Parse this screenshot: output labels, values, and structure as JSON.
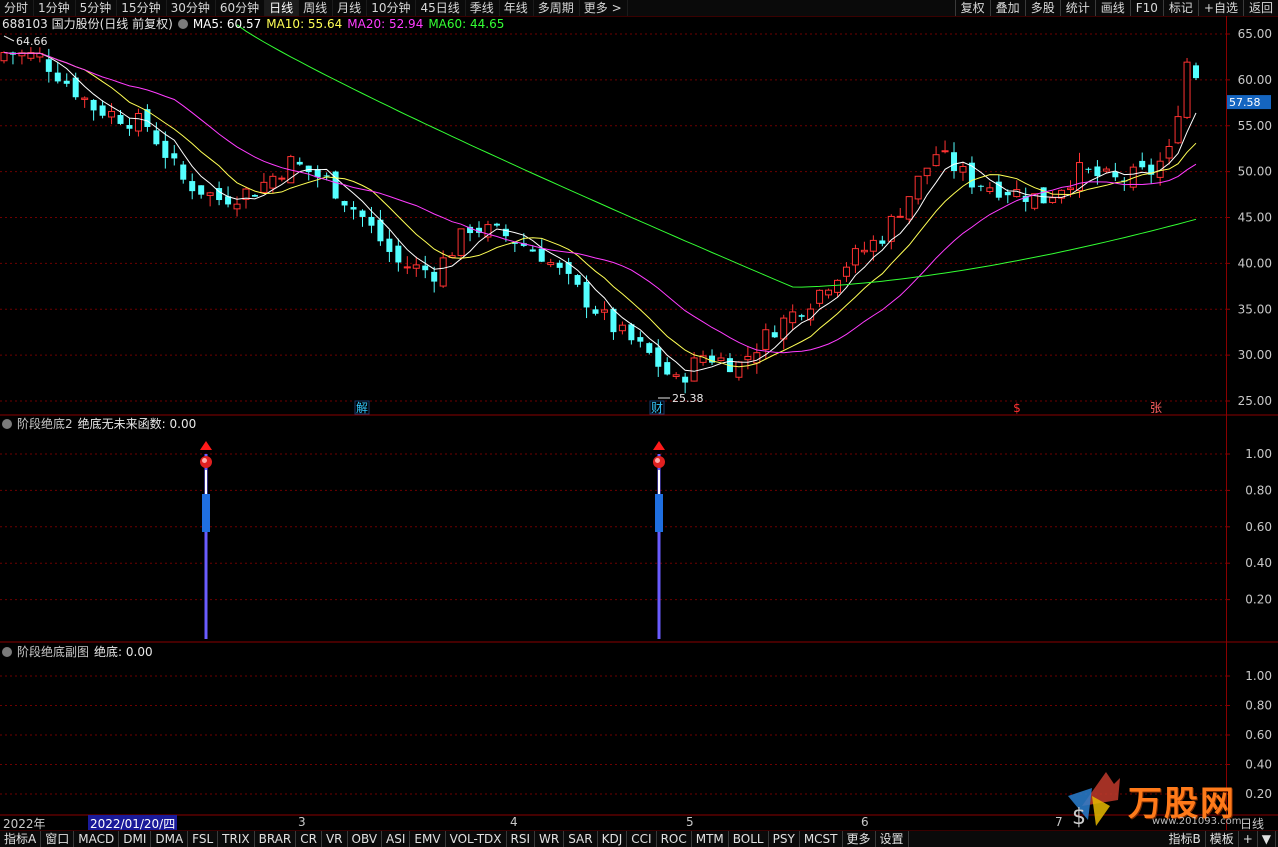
{
  "toolbar": {
    "tabs": [
      "分时",
      "1分钟",
      "5分钟",
      "15分钟",
      "30分钟",
      "60分钟",
      "日线",
      "周线",
      "月线",
      "10分钟",
      "45日线",
      "季线",
      "年线",
      "多周期",
      "更多 >"
    ],
    "active_tab": "日线",
    "right_buttons": [
      "复权",
      "叠加",
      "多股",
      "统计",
      "画线",
      "F10",
      "标记",
      "+自选",
      "返回"
    ]
  },
  "main_chart": {
    "stock": "688103 国力股份(日线 前复权)",
    "ma": [
      {
        "label": "MA5: 60.57",
        "color": "#ffffff"
      },
      {
        "label": "MA10: 55.64",
        "color": "#ffff55"
      },
      {
        "label": "MA20: 52.94",
        "color": "#ff3cff"
      },
      {
        "label": "MA60: 44.65",
        "color": "#33ff33"
      }
    ],
    "price_axis": [
      "65.00",
      "60.00",
      "55.00",
      "50.00",
      "45.00",
      "40.00",
      "35.00",
      "30.00",
      "25.00"
    ],
    "current_price": "57.58",
    "high_label": "64.66",
    "low_label": "25.38",
    "event_markers": [
      {
        "text": "解",
        "color": "#33c8ff"
      },
      {
        "text": "财",
        "color": "#33c8ff"
      },
      {
        "text": "$",
        "color": "#ff3030"
      },
      {
        "text": "张",
        "color": "#ff6060"
      }
    ],
    "colors": {
      "up": "#ff3232",
      "down": "#54ffff",
      "ma5": "#ffffff",
      "ma10": "#ffff55",
      "ma20": "#ff3cff",
      "ma60": "#33ff33",
      "grid": "#6e0000"
    }
  },
  "indicator1": {
    "title": "阶段绝底2",
    "value_label": "绝底无未来函数: 0.00",
    "axis": [
      "1.00",
      "0.80",
      "0.60",
      "0.40",
      "0.20"
    ],
    "signals": [
      {
        "value": 1.0
      },
      {
        "value": 1.0
      }
    ]
  },
  "indicator2": {
    "title": "阶段绝底副图",
    "value_label": "绝底: 0.00",
    "axis": [
      "1.00",
      "0.80",
      "0.60",
      "0.40",
      "0.20"
    ]
  },
  "date_axis": {
    "year": "2022年",
    "cursor_date": "2022/01/20/四",
    "months": [
      "3",
      "4",
      "5",
      "6",
      "7"
    ],
    "period": "日线"
  },
  "bottom_tabs": [
    "指标A",
    "窗口",
    "MACD",
    "DMI",
    "DMA",
    "FSL",
    "TRIX",
    "BRAR",
    "CR",
    "VR",
    "OBV",
    "ASI",
    "EMV",
    "VOL-TDX",
    "RSI",
    "WR",
    "SAR",
    "KDJ",
    "CCI",
    "ROC",
    "MTM",
    "BOLL",
    "PSY",
    "MCST",
    "更多",
    "设置"
  ],
  "bottom_right": [
    "指标B",
    "模板",
    "+",
    "▼"
  ],
  "watermark": {
    "brand": "万股网",
    "url": "www.201093.com"
  }
}
